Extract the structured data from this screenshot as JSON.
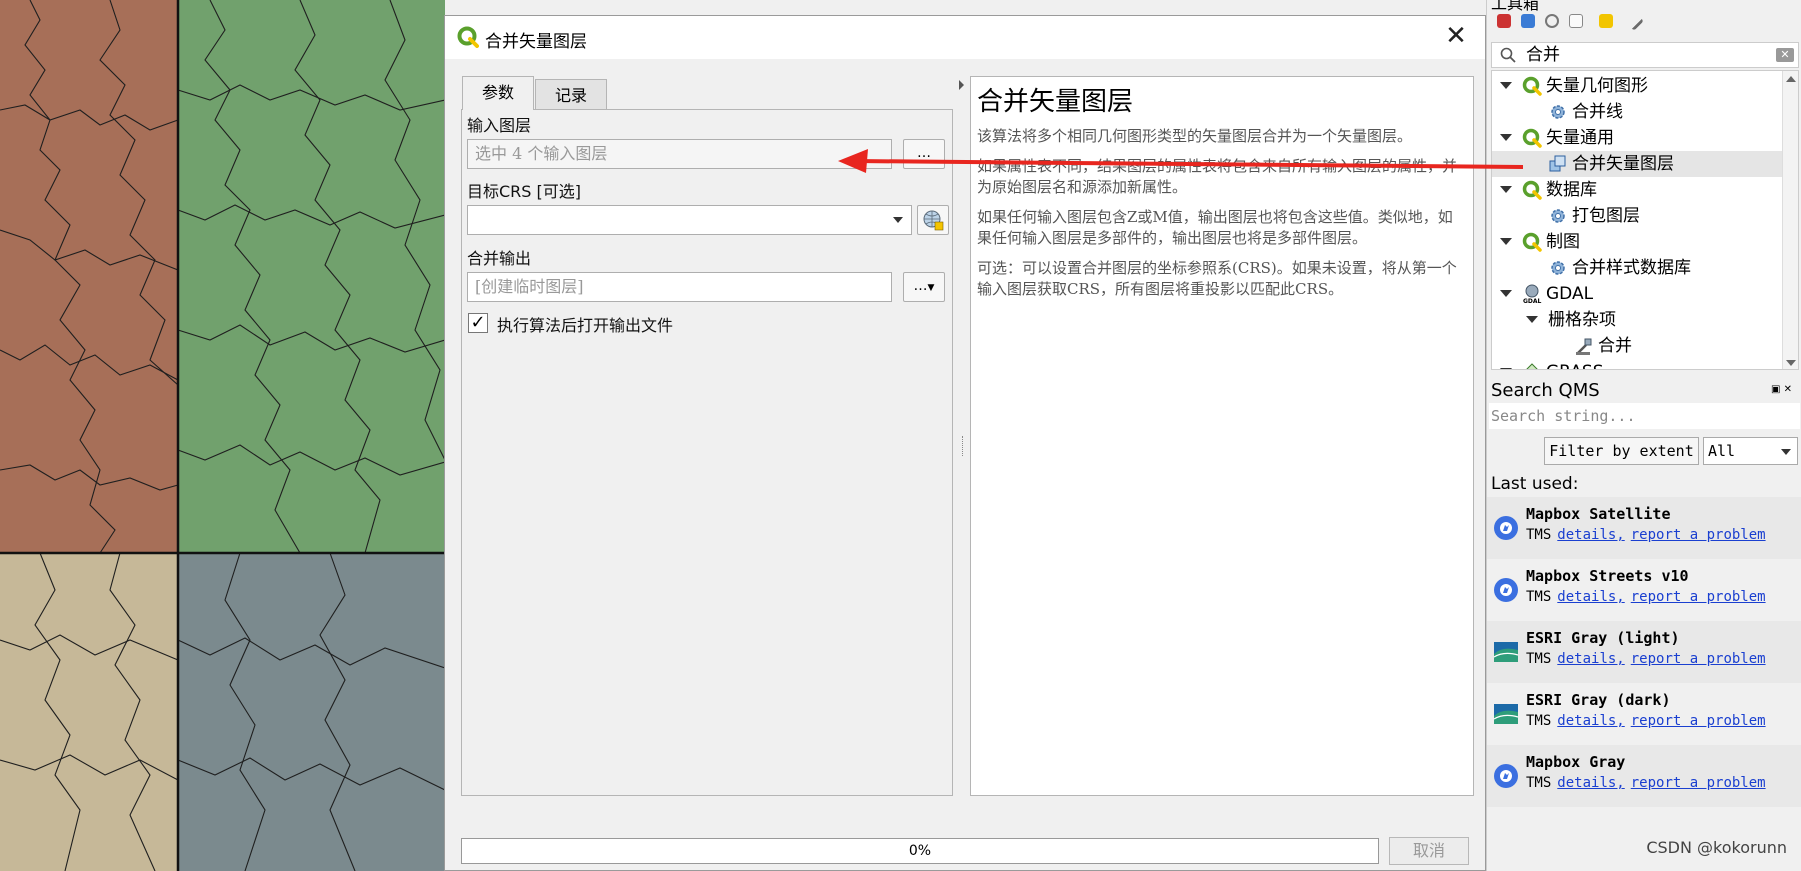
{
  "dialog": {
    "title": "合并矢量图层",
    "tabs": [
      "参数",
      "记录"
    ],
    "input_layers_label": "输入图层",
    "input_layers_value": "选中 4 个输入图层",
    "target_crs_label": "目标CRS [可选]",
    "target_crs_value": "",
    "merged_output_label": "合并输出",
    "merged_output_placeholder": "[创建临时图层]",
    "browse_label": "…",
    "open_output_label": "执行算法后打开输出文件",
    "open_output_checked": true,
    "progress_text": "0%",
    "progress_value": 0,
    "cancel_label": "取消"
  },
  "help": {
    "title": "合并矢量图层",
    "paragraphs": [
      "该算法将多个相同几何图形类型的矢量图层合并为一个矢量图层。",
      "如果属性表不同，结果图层的属性表将包含来自所有输入图层的属性，并为原始图层名和源添加新属性。",
      "如果任何输入图层包含Z或M值，输出图层也将包含这些值。类似地，如果任何输入图层是多部件的，输出图层也将是多部件图层。",
      "可选：可以设置合并图层的坐标参照系(CRS)。如果未设置，将从第一个输入图层获取CRS，所有图层将重投影以匹配此CRS。"
    ]
  },
  "toolbox": {
    "header": "工具箱",
    "search_value": "合并",
    "tree": [
      {
        "label": "矢量几何图形",
        "level": 0,
        "icon": "qgis-logo-icon"
      },
      {
        "label": "合并线",
        "level": 1,
        "icon": "gear-icon"
      },
      {
        "label": "矢量通用",
        "level": 0,
        "icon": "qgis-logo-icon"
      },
      {
        "label": "合并矢量图层",
        "level": 1,
        "icon": "merge-layers-icon",
        "selected": true
      },
      {
        "label": "数据库",
        "level": 0,
        "icon": "qgis-logo-icon"
      },
      {
        "label": "打包图层",
        "level": 1,
        "icon": "gear-icon"
      },
      {
        "label": "制图",
        "level": 0,
        "icon": "qgis-logo-icon"
      },
      {
        "label": "合并样式数据库",
        "level": 1,
        "icon": "gear-icon"
      },
      {
        "label": "GDAL",
        "level": 0,
        "icon": "gdal-icon"
      },
      {
        "label": "栅格杂项",
        "level": 1,
        "icon": ""
      },
      {
        "label": "合并",
        "level": 2,
        "icon": "gdal-tool-icon"
      },
      {
        "label": "GRASS",
        "level": 0,
        "icon": "grass-icon"
      }
    ]
  },
  "qms": {
    "title": "Search QMS",
    "search_placeholder": "Search string...",
    "filter_label": "Filter by extent",
    "filter_option": "All",
    "last_used_label": "Last used:",
    "items": [
      {
        "name": "Mapbox Satellite",
        "type": "TMS",
        "icon": "mapbox-icon"
      },
      {
        "name": "Mapbox Streets v10",
        "type": "TMS",
        "icon": "mapbox-icon"
      },
      {
        "name": "ESRI Gray (light)",
        "type": "TMS",
        "icon": "esri-icon"
      },
      {
        "name": "ESRI Gray (dark)",
        "type": "TMS",
        "icon": "esri-icon"
      },
      {
        "name": "Mapbox Gray",
        "type": "TMS",
        "icon": "mapbox-icon"
      }
    ],
    "details_label": "details,",
    "report_label": "report a problem"
  },
  "watermark": "CSDN @kokorunn",
  "colors": {
    "region_top_left": "#a76f58",
    "region_top_right": "#71a16d",
    "region_bottom_left": "#c6b898",
    "region_bottom_right": "#7b8a8e",
    "annotation_arrow": "#e8261f",
    "link": "#1a3fd0"
  }
}
